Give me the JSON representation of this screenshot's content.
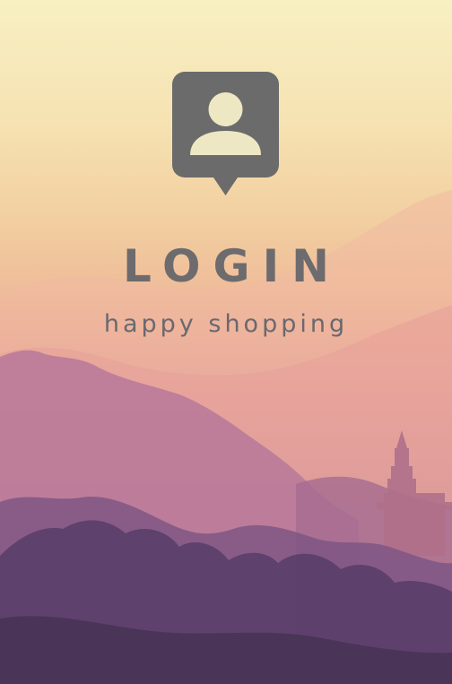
{
  "screen": {
    "title": "LOGIN",
    "subtitle": "happy shopping"
  },
  "icons": {
    "login": "user-location-pin-icon"
  },
  "colors": {
    "text": "#6d6b6d",
    "icon": "#6b6b6b",
    "sky_top": "#f8f0c2",
    "haze": "#efbd9a",
    "hills": "#b97a98",
    "trees": "#4e3a5c"
  }
}
